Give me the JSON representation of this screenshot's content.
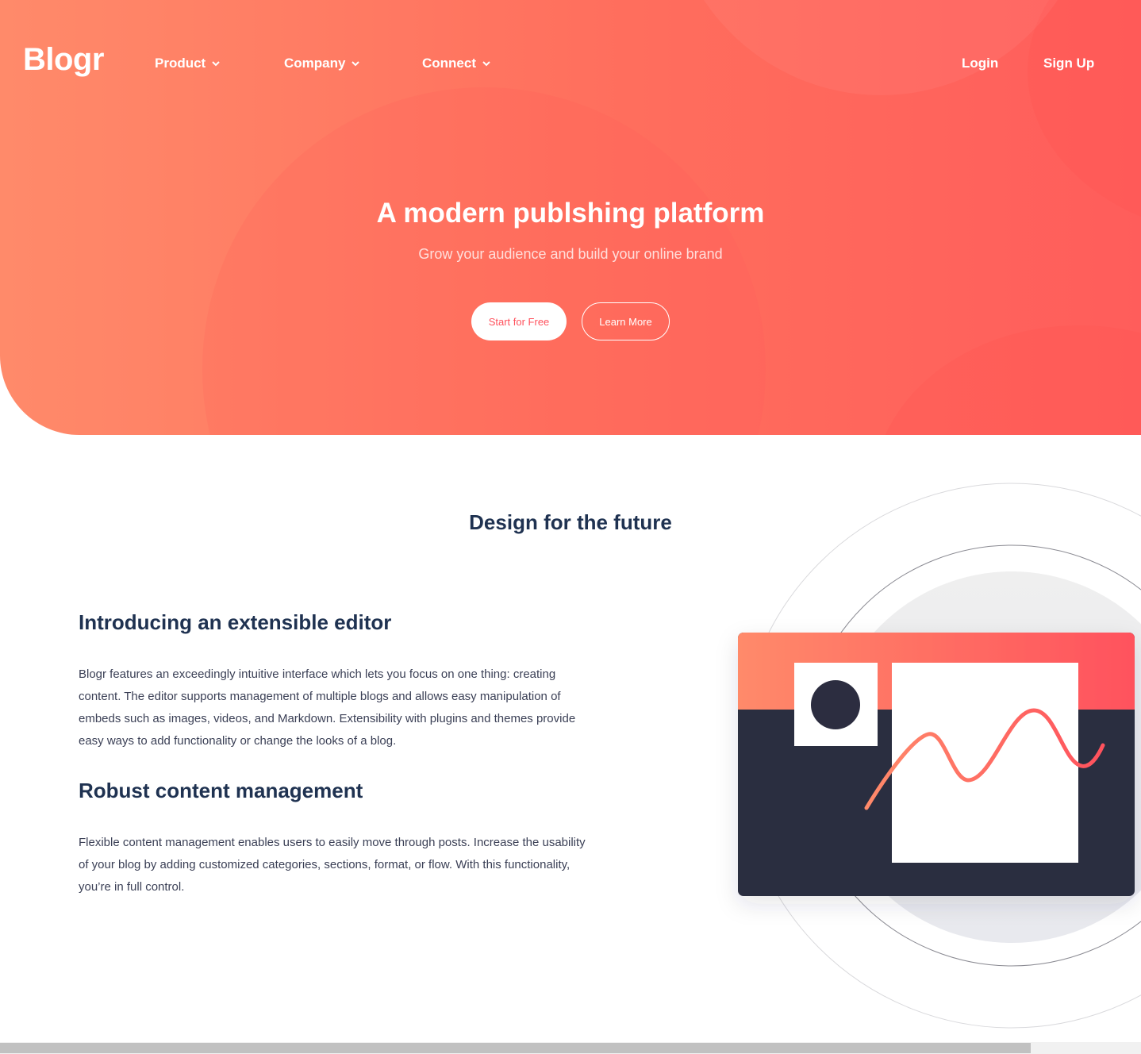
{
  "brand": {
    "logo_text": "Blogr",
    "colors": {
      "hero_gradient_start": "#ff8a6a",
      "hero_gradient_end": "#ff5d5b",
      "primary_red": "#ff525d",
      "heading_navy": "#1f3251",
      "dark_panel": "#2c2d40"
    }
  },
  "nav": {
    "items": [
      {
        "label": "Product",
        "icon": "chevron-down-icon"
      },
      {
        "label": "Company",
        "icon": "chevron-down-icon"
      },
      {
        "label": "Connect",
        "icon": "chevron-down-icon"
      }
    ],
    "login_label": "Login",
    "signup_label": "Sign Up"
  },
  "hero": {
    "title": "A modern publshing platform",
    "subtitle": "Grow your audience and build your online brand",
    "primary_button": "Start for Free",
    "secondary_button": "Learn More"
  },
  "design_section": {
    "title": "Design for the future",
    "features": [
      {
        "heading": "Introducing an extensible editor",
        "body": "Blogr features an exceedingly intuitive interface which lets you focus on one thing: creating content. The editor supports management of multiple blogs and allows easy manipulation of embeds such as images, videos, and Markdown. Extensibility with plugins and themes provide easy ways to add functionality or change the looks of a blog."
      },
      {
        "heading": "Robust content management",
        "body": "Flexible content management enables users to easily move through posts. Increase the usability of your blog by adding customized categories, sections, format, or flow. With this functionality, you’re in full control."
      }
    ],
    "illustration": "editor-illustration"
  }
}
